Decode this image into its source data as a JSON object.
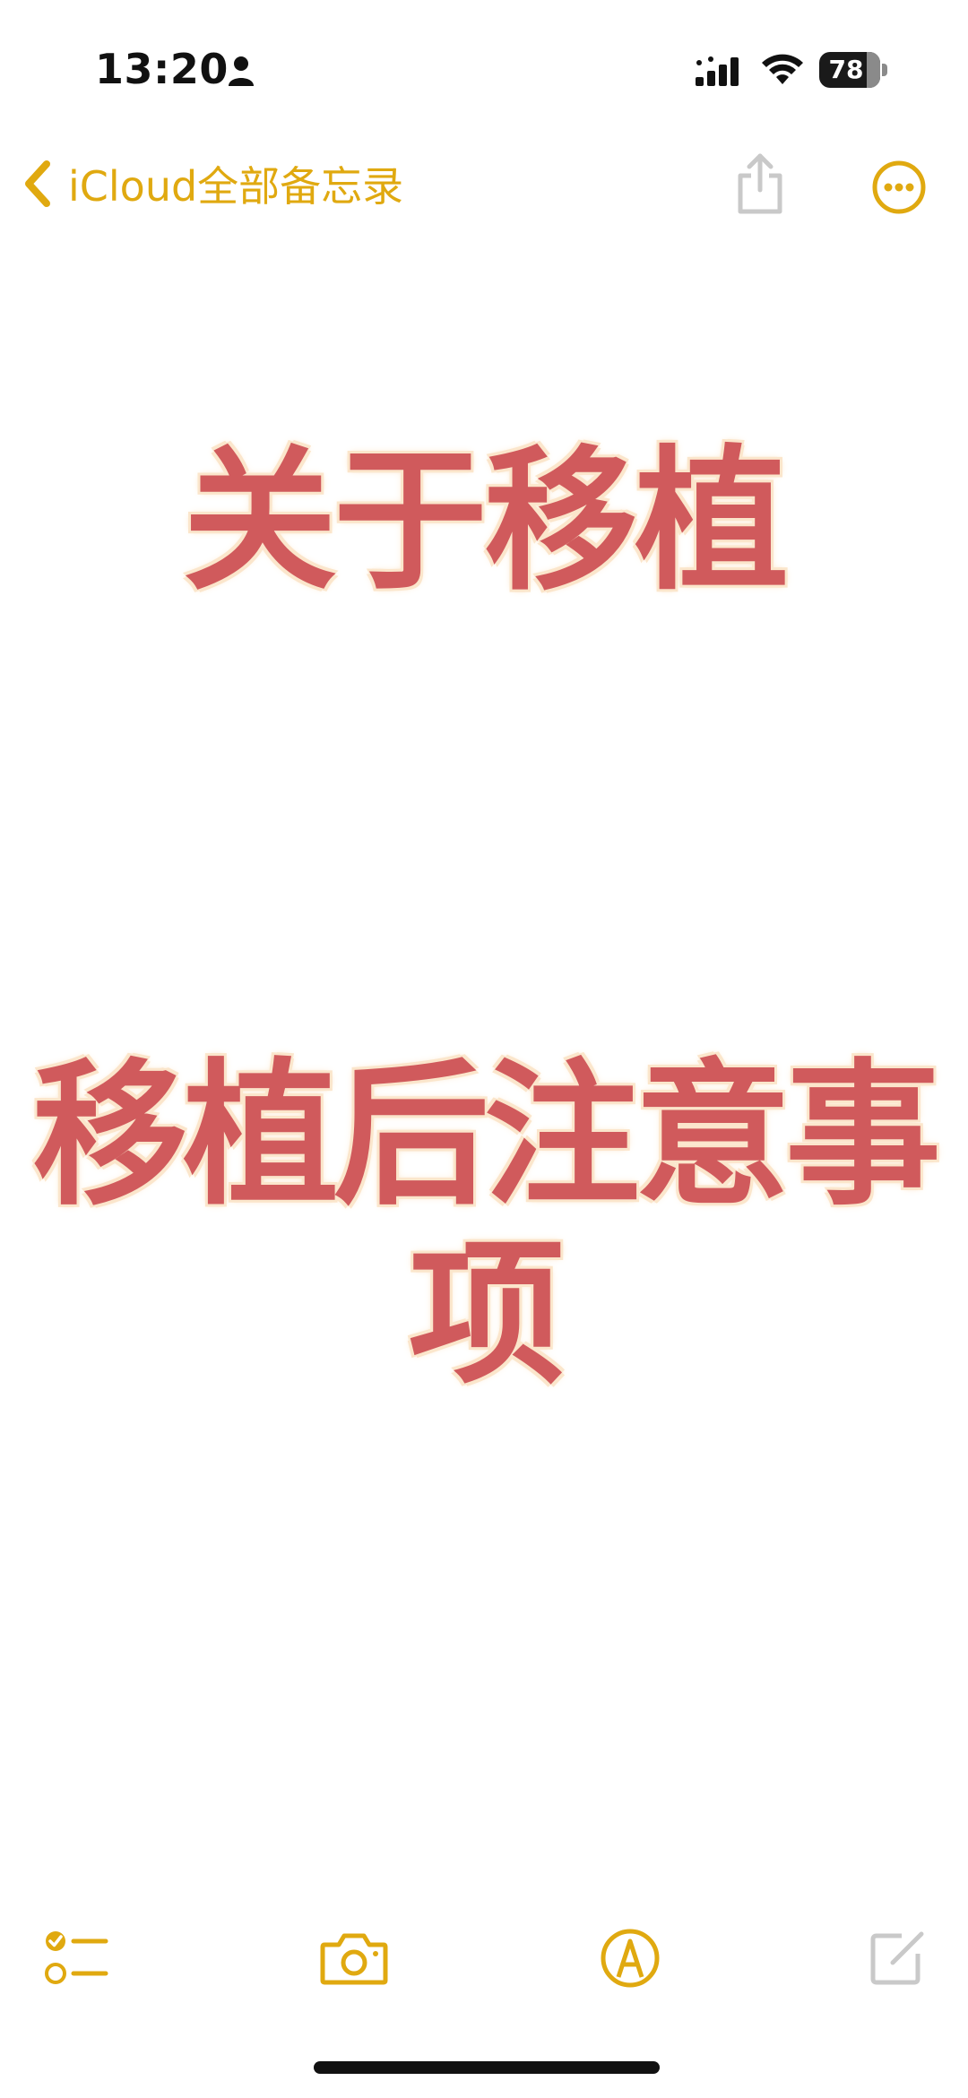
{
  "status_bar": {
    "time": "13:20",
    "battery_level": "78",
    "battery_fraction": 0.78
  },
  "nav": {
    "back_label": "iCloud全部备忘录"
  },
  "note": {
    "headline_1": "关于移植",
    "headline_2": "移植后注意事项"
  },
  "colors": {
    "accent": "#e0a910",
    "headline": "#d05a5c",
    "headline_glow": "#fbe6cc",
    "disabled": "#c9c9c9"
  },
  "icons": {
    "back": "chevron-left-icon",
    "share": "share-icon",
    "more": "ellipsis-circle-icon",
    "checklist": "checklist-icon",
    "camera": "camera-icon",
    "markup": "markup-pen-icon",
    "compose": "compose-icon"
  }
}
